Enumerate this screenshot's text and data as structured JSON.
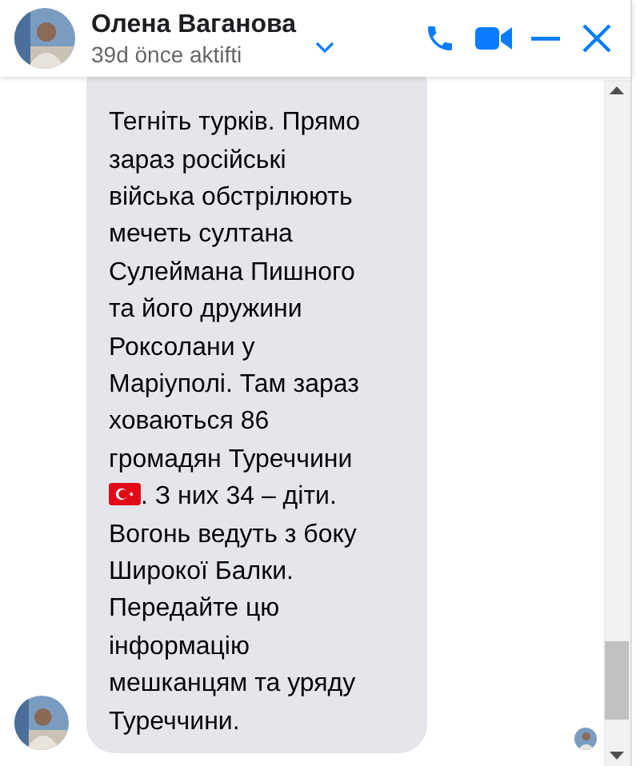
{
  "header": {
    "name": "Олена Ваганова",
    "status": "39d önce aktifti"
  },
  "message": {
    "parts": [
      {
        "kind": "text",
        "text": "Тегніть турків. Прямо\nзараз російські\nвійська обстрілюють\nмечеть султана\nСулеймана Пишного\nта його дружини\nРоксолани у\nМаріуполі. Там зараз\nховаються 86\nгромадян Туреччини\n"
      },
      {
        "kind": "flag"
      },
      {
        "kind": "text",
        "text": ". З них 34 – діти.\n"
      },
      {
        "kind": "text",
        "text": "Вогонь ведуть з боку\nШирокої Балки.\nПередайте цю\nінформацію\nмешканцям та уряду\nТуреччини."
      }
    ]
  }
}
